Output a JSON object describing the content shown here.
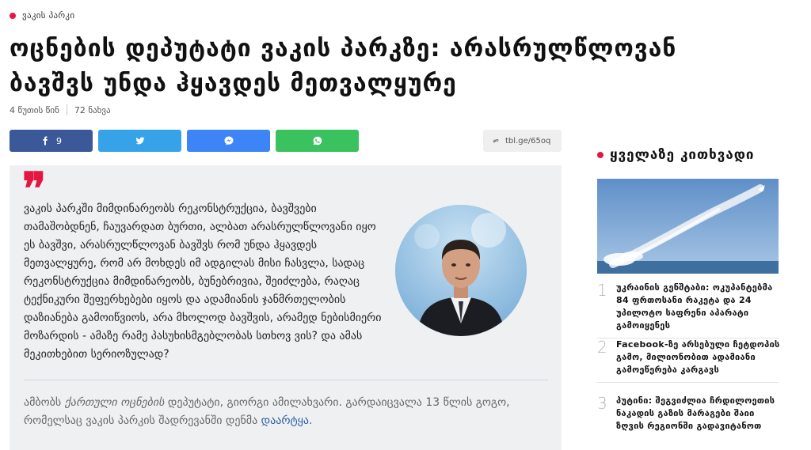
{
  "category": "ვაკის პარკი",
  "headline": "ოცნების დეპუტატი ვაკის პარკზე: არასრულწლოვან ბავშვს უნდა ჰყავდეს მეთვალყურე",
  "meta": {
    "time_ago": "4 წუთის წინ",
    "views": "72 ნახვა"
  },
  "share": {
    "facebook_count": "9",
    "short_link": "tbl.ge/65oq"
  },
  "quote": {
    "mark": "❞",
    "text": "ვაკის პარკში მიმდინარეობს რეკონსტრუქცია, ბავშვები თამაშობდნენ, ჩაუვარდათ ბურთი, ალბათ არასრულწლოვანი იყო ეს ბავშვი, არასრულწლოვან ბავშვს რომ უნდა ჰყავდეს მეთვალყურე, რომ არ მოხდეს იმ ადგილას მისი ჩასვლა, სადაც რეკონსტრუქცია მიმდინარეობს, ბუნებრივია, შეიძლება, რაღაც ტექნიკური შეფერხებები იყოს და ადამიანის ჯანმრთელობის დაზიანება გამოიწვიოს, არა მხოლოდ ბავშვის, არამედ ნებისმიერი მოზარდის - ამაზე რამე პასუხისმგებლობას სთხოვ ვის? და ამას მეკითხებით სერიოზულად?",
    "attribution_prefix": "ამბობს ",
    "attribution_party": "ქართული ოცნების",
    "attribution_middle": " დეპუტატი, გიორგი ამილახვარი. გარდაიცვალა 13 წლის გოგო, რომელსაც ვაკის პარკის შადრევანში დენმა ",
    "attribution_link": "დაარტყა",
    "attribution_end": "."
  },
  "sidebar": {
    "title": "ყველაზე კითხვადი",
    "items": [
      {
        "num": "1",
        "title": "უკრაინის გენშტაბი: ოკუპანტებმა 84 ფრთოსანი რაკეტა და 24 უპილოტო საფრენი აპარატი გამოიყენეს"
      },
      {
        "num": "2",
        "title": "Facebook-ზე არსებული ჩეტდოპის გამო, მილიონობით ადამიანი გამოეწერება კარგავს"
      },
      {
        "num": "3",
        "title": "პუტინი: შეგვიძლია ჩრდილოეთის ნაკადის გაზის მარაგები შაიი ზღვის რეგიონში გადავიტანოთ"
      }
    ]
  },
  "colors": {
    "accent": "#e5173f",
    "facebook": "#3b5998",
    "twitter": "#36a3e8",
    "messenger": "#3d84f7",
    "whatsapp": "#3ac25e"
  }
}
